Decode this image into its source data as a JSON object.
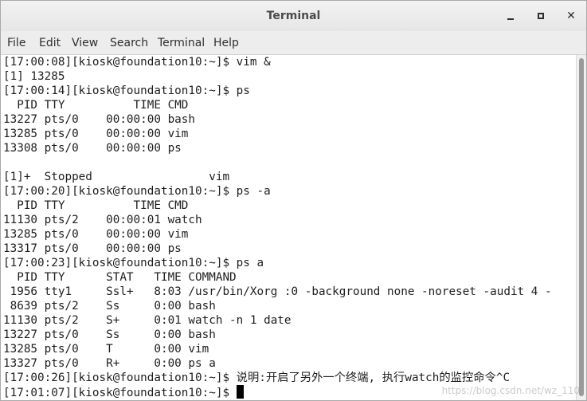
{
  "window": {
    "title": "Terminal"
  },
  "menu": {
    "items": [
      "File",
      "Edit",
      "View",
      "Search",
      "Terminal",
      "Help"
    ]
  },
  "terminal": {
    "lines": [
      "[17:00:08][kiosk@foundation10:~]$ vim &",
      "[1] 13285",
      "[17:00:14][kiosk@foundation10:~]$ ps",
      "  PID TTY          TIME CMD",
      "13227 pts/0    00:00:00 bash",
      "13285 pts/0    00:00:00 vim",
      "13308 pts/0    00:00:00 ps",
      "",
      "[1]+  Stopped                 vim",
      "[17:00:20][kiosk@foundation10:~]$ ps -a",
      "  PID TTY          TIME CMD",
      "11130 pts/2    00:00:01 watch",
      "13285 pts/0    00:00:00 vim",
      "13317 pts/0    00:00:00 ps",
      "[17:00:23][kiosk@foundation10:~]$ ps a",
      "  PID TTY      STAT   TIME COMMAND",
      " 1956 tty1     Ssl+   8:03 /usr/bin/Xorg :0 -background none -noreset -audit 4 -",
      " 8639 pts/2    Ss     0:00 bash",
      "11130 pts/2    S+     0:01 watch -n 1 date",
      "13227 pts/0    Ss     0:00 bash",
      "13285 pts/0    T      0:00 vim",
      "13327 pts/0    R+     0:00 ps a",
      "[17:00:26][kiosk@foundation10:~]$ 说明:开启了另外一个终端, 执行watch的监控命令^C",
      "[17:01:07][kiosk@foundation10:~]$ "
    ]
  },
  "watermark": {
    "text": "https://blog.csdn.net/wz_110"
  },
  "icons": {
    "minimize": "minimize-icon",
    "maximize": "maximize-icon",
    "close": "close-icon",
    "close_glyph": "✕"
  }
}
